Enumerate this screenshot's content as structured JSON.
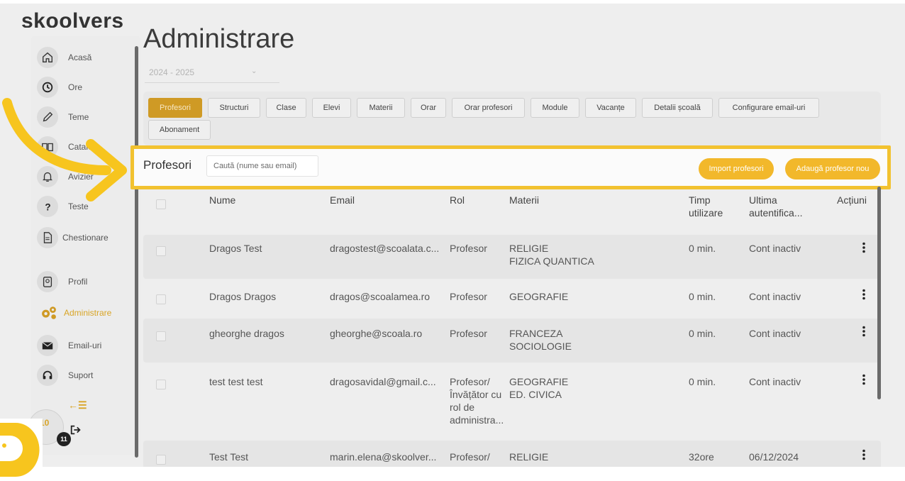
{
  "brand": {
    "name": "skoolvers"
  },
  "sidebar": {
    "items": [
      {
        "label": "Acasă",
        "icon": "home-icon"
      },
      {
        "label": "Ore",
        "icon": "clock-icon"
      },
      {
        "label": "Teme",
        "icon": "pencil-icon"
      },
      {
        "label": "Catalog",
        "icon": "book-icon"
      },
      {
        "label": "Avizier",
        "icon": "bell-icon"
      },
      {
        "label": "Teste",
        "icon": "question-icon"
      },
      {
        "label": "Chestionare",
        "icon": "document-icon"
      },
      {
        "label": "Profil",
        "icon": "profile-icon"
      },
      {
        "label": "Administrare",
        "icon": "gears-icon",
        "active": true
      },
      {
        "label": "Email-uri",
        "icon": "envelope-icon"
      },
      {
        "label": "Suport",
        "icon": "headset-icon"
      }
    ],
    "collapse_label": "←☰",
    "avatar_number": "10",
    "notification_count": "11"
  },
  "page": {
    "title": "Administrare",
    "year": "2024 - 2025"
  },
  "tabs": [
    "Profesori",
    "Structuri",
    "Clase",
    "Elevi",
    "Materii",
    "Orar",
    "Orar profesori",
    "Module",
    "Vacanțe",
    "Detalii școală",
    "Configurare email-uri",
    "Abonament"
  ],
  "active_tab": "Profesori",
  "section": {
    "title": "Profesori",
    "search_placeholder": "Caută (nume sau email)",
    "import_button": "Import profesori",
    "add_button": "Adaugă profesor nou"
  },
  "table": {
    "headers": {
      "name": "Nume",
      "email": "Email",
      "role": "Rol",
      "subjects": "Materii",
      "usage_line1": "Timp",
      "usage_line2": "utilizare",
      "login_line1": "Ultima",
      "login_line2": "autentifica...",
      "actions": "Acțiuni"
    },
    "rows": [
      {
        "name": "Dragos Test",
        "email": "dragostest@scoalata.c...",
        "role": [
          "Profesor"
        ],
        "subjects": [
          "RELIGIE",
          "FIZICA QUANTICA"
        ],
        "usage": "0 min.",
        "last_login": "Cont inactiv"
      },
      {
        "name": "Dragos Dragos",
        "email": "dragos@scoalamea.ro",
        "role": [
          "Profesor"
        ],
        "subjects": [
          "GEOGRAFIE"
        ],
        "usage": "0 min.",
        "last_login": "Cont inactiv"
      },
      {
        "name": "gheorghe dragos",
        "email": "gheorghe@scoala.ro",
        "role": [
          "Profesor"
        ],
        "subjects": [
          "FRANCEZA",
          "SOCIOLOGIE"
        ],
        "usage": "0 min.",
        "last_login": "Cont inactiv"
      },
      {
        "name": "test test test",
        "email": "dragosavidal@gmail.c...",
        "role": [
          "Profesor/",
          "Învățător cu",
          "rol de",
          "administra..."
        ],
        "subjects": [
          "GEOGRAFIE",
          "ED. CIVICA"
        ],
        "usage": "0 min.",
        "last_login": "Cont inactiv"
      },
      {
        "name": "Test Test",
        "email": "marin.elena@skoolver...",
        "role": [
          "Profesor/"
        ],
        "subjects": [
          "RELIGIE"
        ],
        "usage": "32ore",
        "last_login": "06/12/2024"
      }
    ]
  },
  "colors": {
    "accent": "#cf9a25",
    "button": "#f2b82b",
    "highlight": "#f2c230",
    "overlay_arrow": "#f7c51e"
  }
}
